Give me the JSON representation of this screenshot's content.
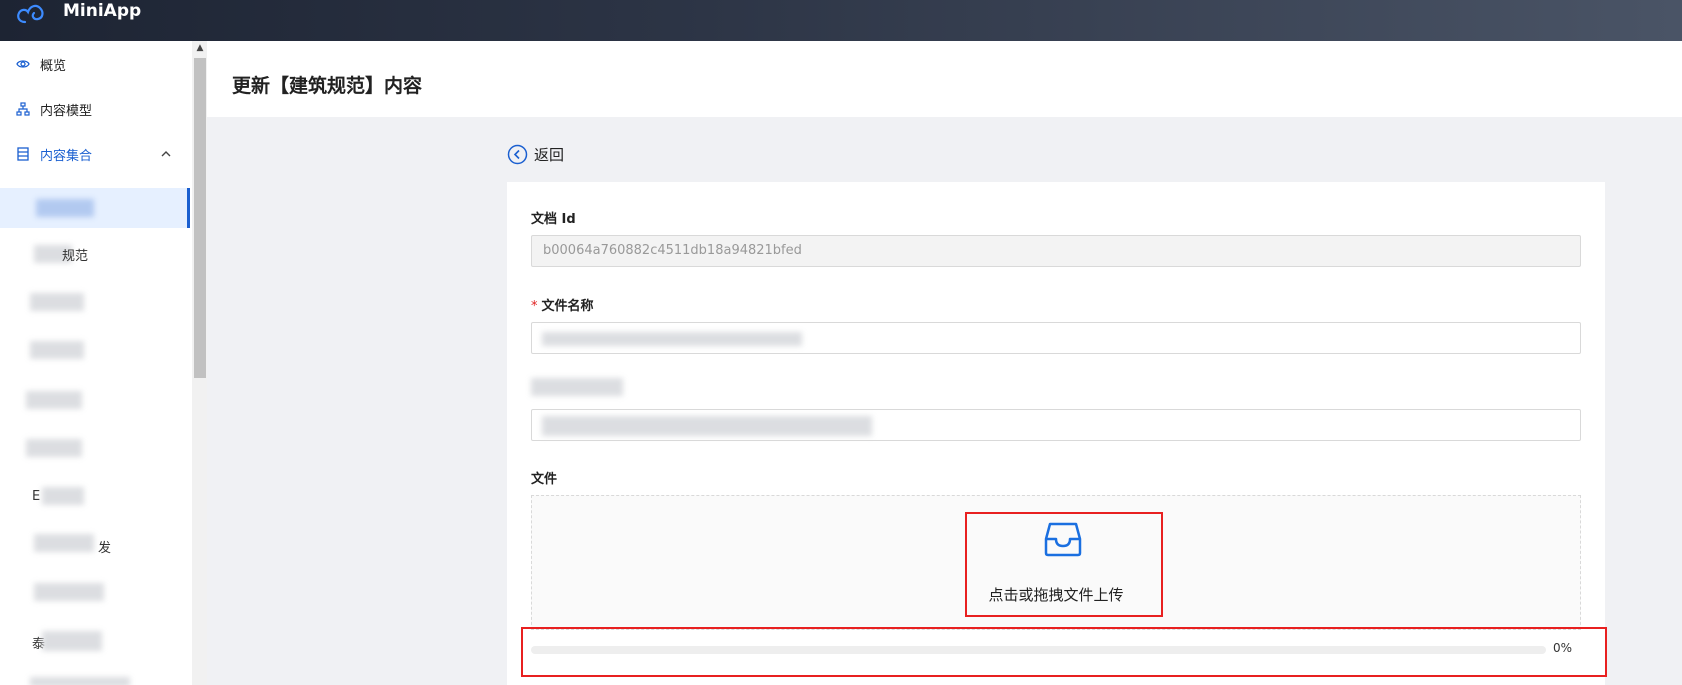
{
  "app": {
    "title": "MiniApp"
  },
  "sidebar": {
    "items": [
      {
        "label": "概览",
        "icon": "eye-icon"
      },
      {
        "label": "内容模型",
        "icon": "sitemap-icon"
      },
      {
        "label": "内容集合",
        "icon": "database-icon"
      }
    ],
    "partial_texts": [
      "规范",
      "",
      "",
      "",
      "",
      "",
      "E",
      "发",
      "",
      "泰"
    ]
  },
  "page": {
    "title": "更新【建筑规范】内容"
  },
  "back": {
    "label": "返回"
  },
  "form": {
    "doc_id_label": "文档 Id",
    "doc_id_value": "b00064a760882c4511db18a94821bfed",
    "file_name_label": "文件名称",
    "file_label": "文件",
    "upload_text": "点击或拖拽文件上传"
  },
  "progress": {
    "percent_text": "0%",
    "value": 0
  },
  "colors": {
    "accent": "#1a6fe0",
    "highlight": "#e82020"
  }
}
